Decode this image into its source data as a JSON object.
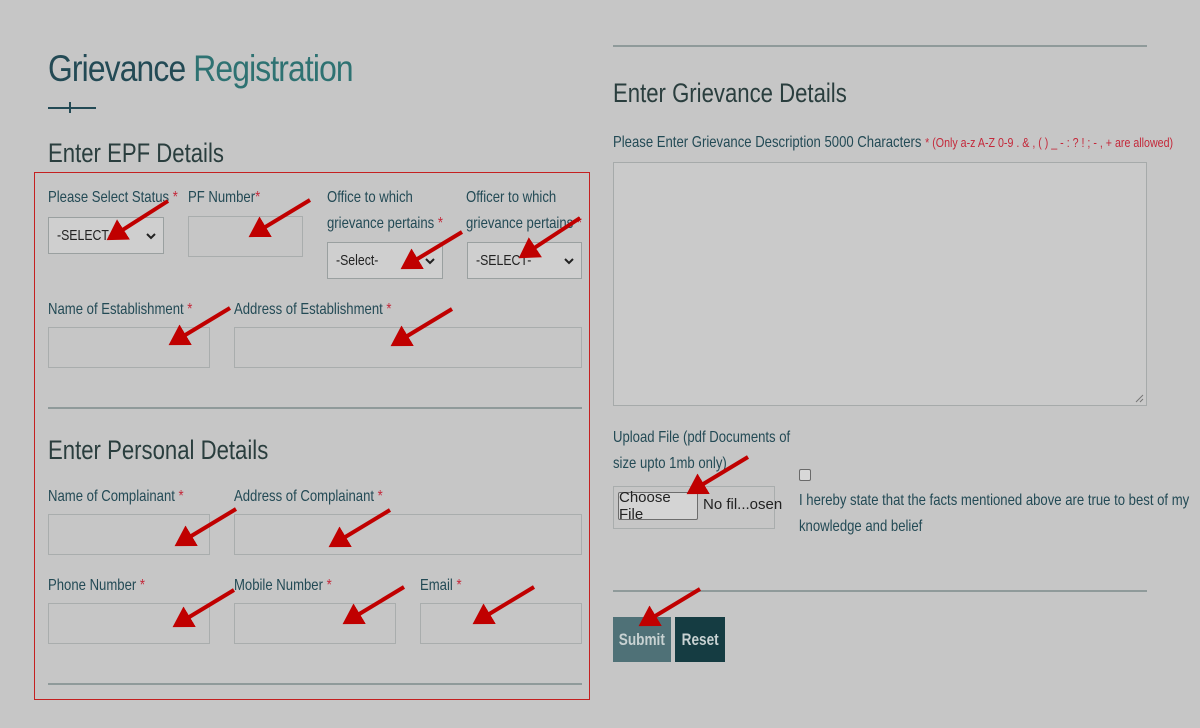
{
  "title": {
    "word1": "Grievance",
    "word2": "Registration"
  },
  "epf": {
    "heading": "Enter EPF Details",
    "status_label": "Please Select Status",
    "status_value": "-SELECT-",
    "pf_label": "PF Number",
    "office_label_line1": "Office to which",
    "office_label_line2": "grievance pertains",
    "office_value": "-Select-",
    "officer_label_line1": "Officer to which",
    "officer_label_line2": "grievance pertains",
    "officer_value": "-SELECT-",
    "est_name_label": "Name of Establishment",
    "est_address_label": "Address of Establishment"
  },
  "personal": {
    "heading": "Enter Personal Details",
    "complainant_name_label": "Name of Complainant",
    "complainant_address_label": "Address of Complainant",
    "phone_label": "Phone Number",
    "mobile_label": "Mobile Number",
    "email_label": "Email"
  },
  "grievance": {
    "heading": "Enter Grievance Details",
    "desc_label": "Please Enter Grievance Description 5000 Characters",
    "desc_note": "* (Only a-z A-Z 0-9 . & , ( ) _ - : ? ! ; - , + are allowed)",
    "upload_label_line1": "Upload File (pdf Documents of",
    "upload_label_line2": "size upto 1mb only)",
    "choose_file": "Choose File",
    "file_status": "No fil...osen",
    "declaration_line1": "I hereby state that the facts mentioned above are true to best of my",
    "declaration_line2": "knowledge and belief"
  },
  "buttons": {
    "submit": "Submit",
    "reset": "Reset"
  },
  "required_mark": "*",
  "colors": {
    "background": "#c6c6c6",
    "title_accent": "#2e7272",
    "required": "#c4283a",
    "annotation_arrow": "#c00000",
    "submit_bg": "#4f7177",
    "reset_bg": "#153c42"
  }
}
